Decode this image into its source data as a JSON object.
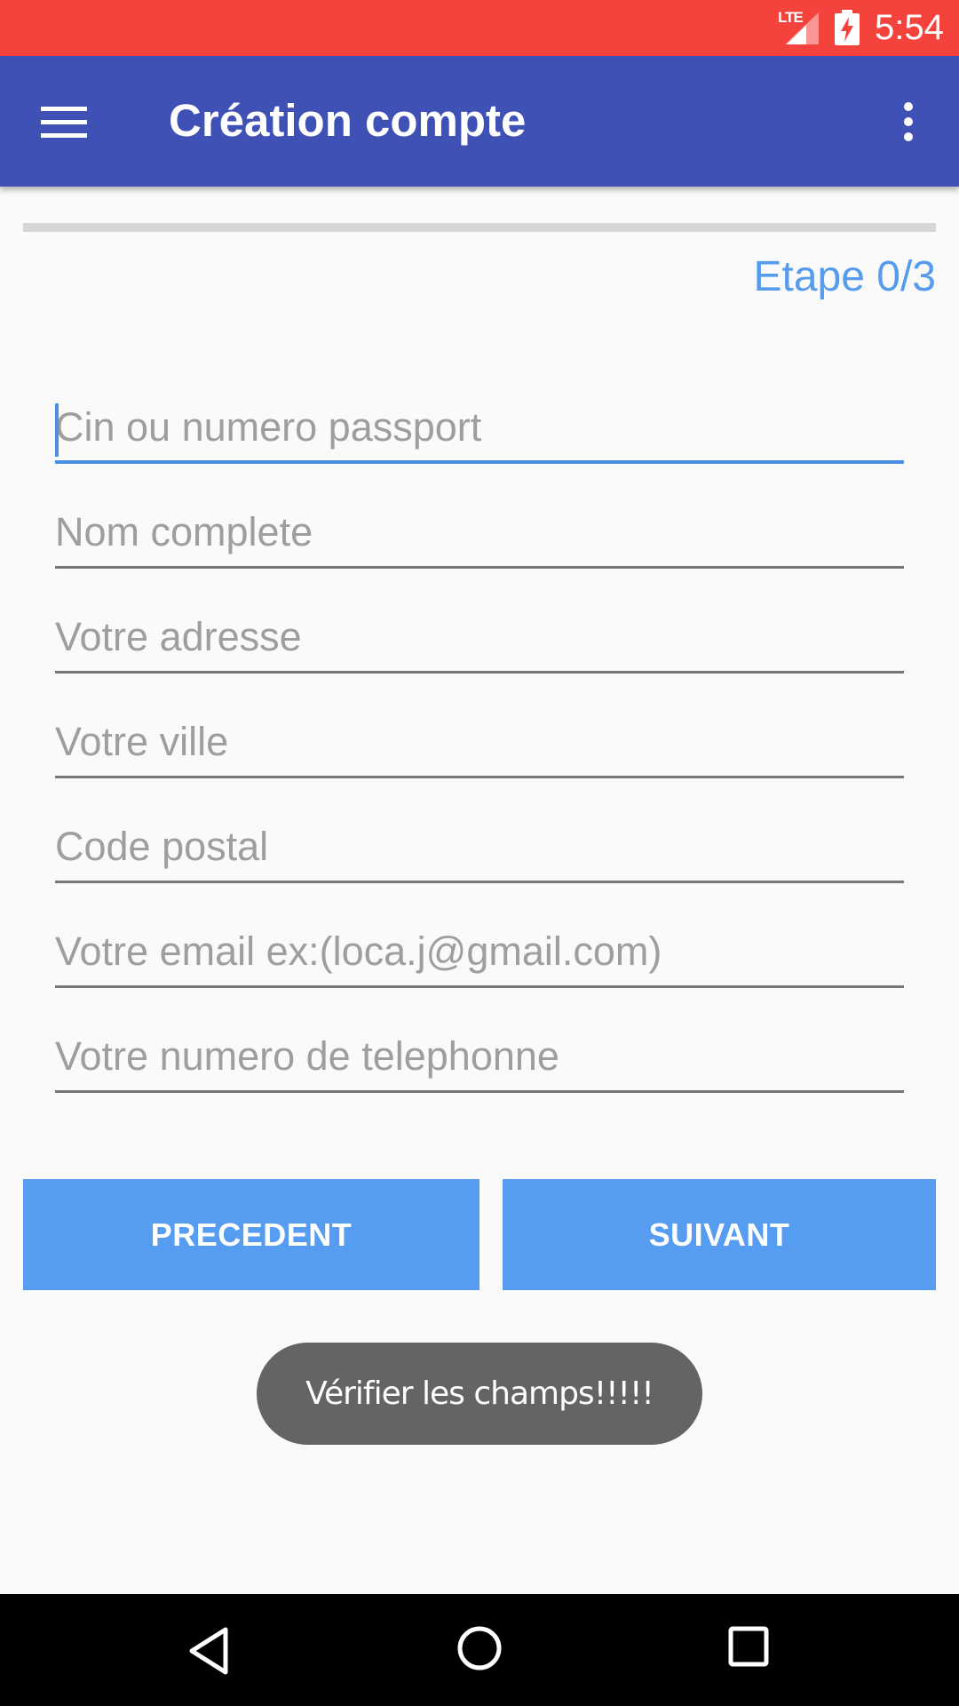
{
  "status_bar": {
    "network": "LTE",
    "time": "5:54",
    "icons": [
      "signal-icon",
      "battery-charging-icon"
    ],
    "color": "#F4433C"
  },
  "toolbar": {
    "title": "Création compte",
    "menu_icon": "hamburger-menu-icon",
    "overflow_icon": "more-vert-icon",
    "color": "#3F51B5"
  },
  "progress": {
    "value": 0,
    "max": 3,
    "label": "Etape 0/3"
  },
  "form": {
    "fields": [
      {
        "placeholder": "Cin ou numero passport",
        "value": "",
        "focused": true
      },
      {
        "placeholder": "Nom complete",
        "value": ""
      },
      {
        "placeholder": "Votre adresse",
        "value": ""
      },
      {
        "placeholder": "Votre ville",
        "value": ""
      },
      {
        "placeholder": "Code postal",
        "value": ""
      },
      {
        "placeholder": "Votre email ex:(loca.j@gmail.com)",
        "value": ""
      },
      {
        "placeholder": "Votre numero de telephonne",
        "value": ""
      }
    ]
  },
  "buttons": {
    "previous": "PRECEDENT",
    "next": "SUIVANT",
    "color": "#569CF1"
  },
  "toast": {
    "message": "Vérifier les champs!!!!!"
  },
  "nav_bar": {
    "icons": [
      "back-icon",
      "home-icon",
      "recents-icon"
    ]
  }
}
